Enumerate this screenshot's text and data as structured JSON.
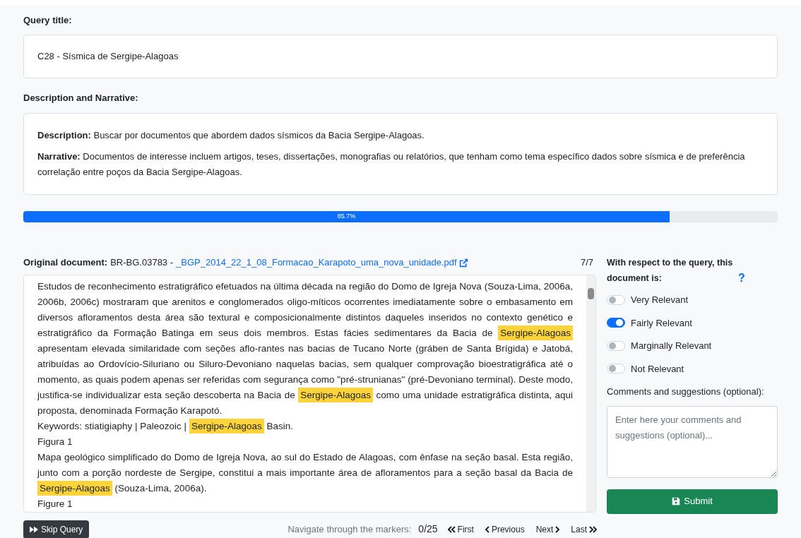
{
  "query_title": {
    "label": "Query title:",
    "value": "C28 - Sísmica de Sergipe-Alagoas"
  },
  "description": {
    "label": "Description and Narrative:",
    "items": [
      {
        "label": "Description:",
        "text": "Buscar por documentos que abordem dados sísmicos da Bacia Sergipe-Alagoas."
      },
      {
        "label": "Narrative:",
        "text": "Documentos de interesse incluem artigos, teses, dissertações, monografias ou relatórios, que tenham como tema específico dados sobre sísmica e de preferência correlação entre poços da Bacia Sergipe-Alagoas."
      }
    ]
  },
  "progress": {
    "level": 0.857,
    "reading": "85.7%"
  },
  "document": {
    "label": "Original document:",
    "id": "BR-BG.03783 -",
    "link": "_BGP_2014_22_1_08_Formacao_Karapoto_uma_nova_unidade.pdf",
    "counter": "7/7",
    "paragraphs": [
      [
        {
          "text": "Estudos de reconhecimento estratigráfico efetuados na última década na região do Domo de Igreja Nova (Souza-Lima, 2006a, 2006b, 2006c) mostraram que arenitos e conglomerados oligo-míticos ocorrentes imediatamente sobre o embasamento em diversos afloramentos desta área são textural e composicionalmente distintos daqueles inseridos no contexto genético e estratigráfico da Formação Batinga em seus dois membros. Estas fácies sedimentares da Bacia de ",
          "highlighted": false
        },
        {
          "text": "Sergipe-Alagoas",
          "highlighted": true
        },
        {
          "text": " apresentam elevada similaridade com seções aflo-rantes nas bacias de Tucano Norte (gráben de Santa Brígida) e Jatobá, atribuídas ao Ordovício-Siluriano ou Siluro-Devoniano naquelas bacias, sem qualquer comprovação bioestratigráfica até o momento, as quais podem apenas ser referidas com segurança como \"pré-strunianas\" (pré-Devoniano terminal). Deste modo, justifica-se individualizar esta seção descoberta na Bacia de ",
          "highlighted": false
        },
        {
          "text": "Sergipe-Alagoas",
          "highlighted": true
        },
        {
          "text": " como uma unidade estratigráfica distinta, aqui proposta, denominada Formação Karapotó.",
          "highlighted": false
        }
      ],
      [
        {
          "text": "Keywords: stiatigiaphy | Paleozoic | ",
          "highlighted": false
        },
        {
          "text": "Sergipe-Alagoas",
          "highlighted": true
        },
        {
          "text": " Basin.",
          "highlighted": false
        }
      ],
      [
        {
          "text": "Figura 1",
          "highlighted": false
        }
      ],
      [
        {
          "text": "Mapa geológico simplificado do Domo de Igreja Nova, ao sul do Estado de Alagoas, com ênfase na seção basal. Esta região, junto com a porção nordeste de Sergipe, constitui a mais importante área de afloramentos para a seção basal da Bacia de ",
          "highlighted": false
        },
        {
          "text": "Sergipe-Alagoas",
          "highlighted": true
        },
        {
          "text": " (Souza-Lima, 2006a).",
          "highlighted": false
        }
      ],
      [
        {
          "text": "Figure 1",
          "highlighted": false
        }
      ]
    ]
  },
  "relevance": {
    "question": "With respect to the query, this document is:",
    "help": "?",
    "options": [
      {
        "label": "Very Relevant",
        "on": false
      },
      {
        "label": "Fairly Relevant",
        "on": true
      },
      {
        "label": "Marginally Relevant",
        "on": false
      },
      {
        "label": "Not Relevant",
        "on": false
      }
    ],
    "comments_label": "Comments and suggestions (optional):",
    "comments_placeholder": "Enter here your comments and suggestions (optional)...",
    "submit": "Submit"
  },
  "footer": {
    "skip": "Skip Query",
    "nav_label": "Navigate through the markers:",
    "nav_count": "0/25",
    "first": "First",
    "previous": "Previous",
    "next": "Next",
    "last": "Last"
  }
}
